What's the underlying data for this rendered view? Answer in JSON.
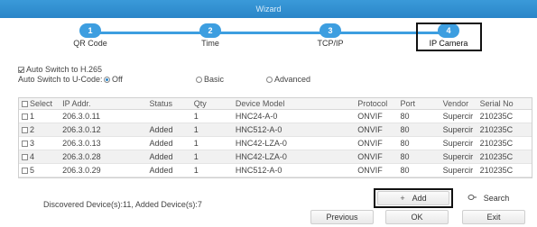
{
  "window": {
    "title": "Wizard"
  },
  "steps": [
    {
      "number": "1",
      "label": "QR Code"
    },
    {
      "number": "2",
      "label": "Time"
    },
    {
      "number": "3",
      "label": "TCP/IP"
    },
    {
      "number": "4",
      "label": "IP Camera"
    }
  ],
  "options": {
    "h265_label": "Auto Switch to H.265",
    "h265_checked": true,
    "ucode_label": "Auto Switch to U-Code:",
    "ucode_options": [
      "Off",
      "Basic",
      "Advanced"
    ],
    "ucode_selected": "Off"
  },
  "table": {
    "columns": [
      "Select",
      "IP Addr.",
      "Status",
      "Qty",
      "Device Model",
      "Protocol",
      "Port",
      "Vendor",
      "Serial No"
    ],
    "rows": [
      [
        "1",
        "206.3.0.11",
        "",
        "1",
        "HNC24-A-0",
        "ONVIF",
        "80",
        "Supercir",
        "210235C"
      ],
      [
        "2",
        "206.3.0.12",
        "Added",
        "1",
        "HNC512-A-0",
        "ONVIF",
        "80",
        "Supercir",
        "210235C"
      ],
      [
        "3",
        "206.3.0.13",
        "Added",
        "1",
        "HNC42-LZA-0",
        "ONVIF",
        "80",
        "Supercir",
        "210235C"
      ],
      [
        "4",
        "206.3.0.28",
        "Added",
        "1",
        "HNC42-LZA-0",
        "ONVIF",
        "80",
        "Supercir",
        "210235C"
      ],
      [
        "5",
        "206.3.0.29",
        "Added",
        "1",
        "HNC512-A-0",
        "ONVIF",
        "80",
        "Supercir",
        "210235C"
      ]
    ]
  },
  "footer": {
    "status_text": "Discovered Device(s):11, Added Device(s):7",
    "add_icon": "+",
    "add_label": "Add",
    "search_icon": "search-icon",
    "search_label": "Search",
    "previous_label": "Previous",
    "ok_label": "OK",
    "exit_label": "Exit"
  },
  "colors": {
    "accent": "#3d9ee0",
    "titlebar": "#2a85c8"
  }
}
